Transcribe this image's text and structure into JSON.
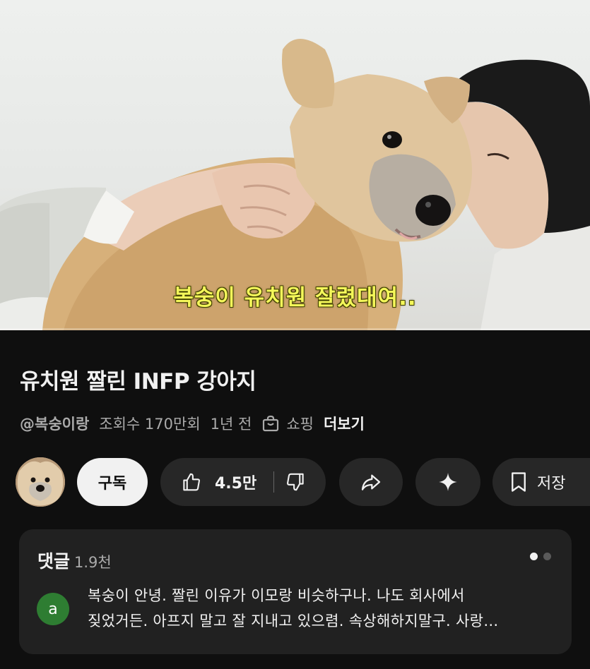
{
  "video": {
    "subtitle": "복숭이 유치원 잘렸대여.."
  },
  "title": "유치원 짤린 INFP 강아지",
  "meta": {
    "channel": "@복숭이랑",
    "views": "조회수 170만회",
    "age": "1년 전",
    "shopping": "쇼핑",
    "more": "더보기"
  },
  "actions": {
    "subscribe": "구독",
    "likes": "4.5만",
    "save": "저장"
  },
  "comments": {
    "header": "댓글",
    "count": "1.9천",
    "top": {
      "avatar_letter": "a",
      "line1": "복숭이 안녕. 짤린 이유가 이모랑 비슷하구나. 나도 회사에서",
      "line2": "짖었거든. 아프지 말고 잘 지내고 있으렴. 속상해하지말구. 사랑…"
    }
  },
  "colors": {
    "background": "#0f0f0f",
    "pill": "#272727",
    "subscribe_bg": "#f1f1f1",
    "comment_card": "#212121",
    "comment_avatar": "#2e7d32",
    "subtitle": "#f4f75a"
  }
}
